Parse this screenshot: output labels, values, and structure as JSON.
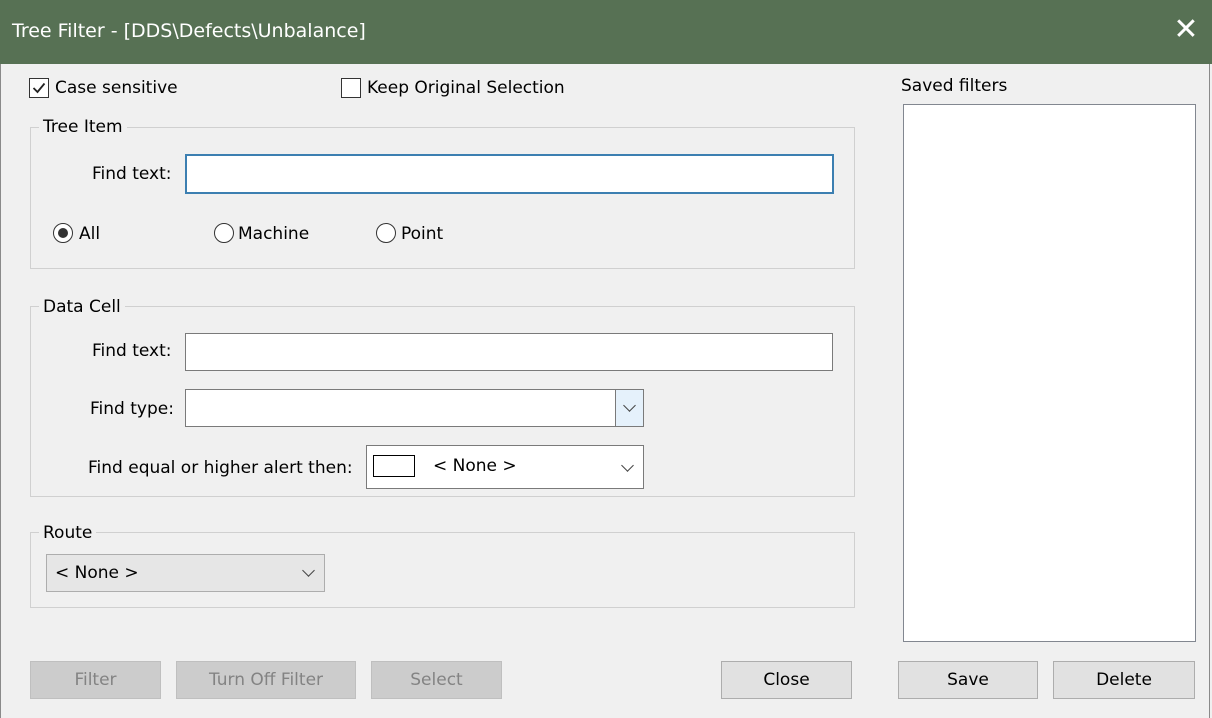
{
  "window": {
    "title": "Tree Filter - [DDS\\Defects\\Unbalance]",
    "close_glyph": "✕"
  },
  "options": {
    "case_sensitive_label": "Case sensitive",
    "case_sensitive_checked": true,
    "keep_original_label": "Keep Original Selection",
    "keep_original_checked": false
  },
  "tree_item": {
    "legend": "Tree Item",
    "find_text_label": "Find text:",
    "find_text_value": "",
    "radios": [
      {
        "label": "All",
        "selected": true
      },
      {
        "label": "Machine",
        "selected": false
      },
      {
        "label": "Point",
        "selected": false
      }
    ]
  },
  "data_cell": {
    "legend": "Data Cell",
    "find_text_label": "Find text:",
    "find_text_value": "",
    "find_type_label": "Find type:",
    "find_type_value": "",
    "alert_label": "Find equal or higher alert then:",
    "alert_value": "< None >",
    "alert_swatch_color": "#ffffff"
  },
  "route": {
    "legend": "Route",
    "value": "< None >"
  },
  "saved_filters": {
    "label": "Saved filters",
    "items": []
  },
  "buttons": {
    "filter": "Filter",
    "turn_off": "Turn Off Filter",
    "select": "Select",
    "close": "Close",
    "save": "Save",
    "delete": "Delete"
  },
  "colors": {
    "titlebar": "#577154",
    "focus_border": "#3c7fb1"
  }
}
